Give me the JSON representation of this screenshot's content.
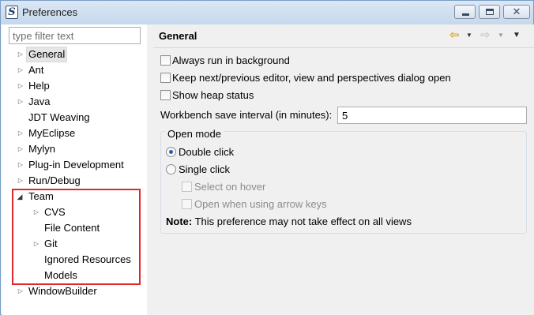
{
  "window": {
    "title": "Preferences",
    "icon": "app-s-icon"
  },
  "filter": {
    "placeholder": "type filter text"
  },
  "tree": {
    "items": [
      {
        "label": "General",
        "expander": "collapsed",
        "selected": true
      },
      {
        "label": "Ant",
        "expander": "collapsed"
      },
      {
        "label": "Help",
        "expander": "collapsed"
      },
      {
        "label": "Java",
        "expander": "collapsed"
      },
      {
        "label": "JDT Weaving",
        "expander": "none"
      },
      {
        "label": "MyEclipse",
        "expander": "collapsed"
      },
      {
        "label": "Mylyn",
        "expander": "collapsed"
      },
      {
        "label": "Plug-in Development",
        "expander": "collapsed"
      },
      {
        "label": "Run/Debug",
        "expander": "collapsed"
      },
      {
        "label": "Team",
        "expander": "expanded"
      },
      {
        "label": "CVS",
        "expander": "collapsed"
      },
      {
        "label": "File Content",
        "expander": "none"
      },
      {
        "label": "Git",
        "expander": "collapsed"
      },
      {
        "label": "Ignored Resources",
        "expander": "none"
      },
      {
        "label": "Models",
        "expander": "none"
      },
      {
        "label": "WindowBuilder",
        "expander": "collapsed"
      }
    ]
  },
  "page": {
    "title": "General",
    "options": {
      "always_run_background": {
        "label": "Always run in background",
        "checked": false
      },
      "keep_next_prev": {
        "label": "Keep next/previous editor, view and perspectives dialog open",
        "checked": false
      },
      "show_heap": {
        "label": "Show heap status",
        "checked": false
      }
    },
    "save_interval": {
      "label": "Workbench save interval (in minutes):",
      "value": "5"
    },
    "open_mode": {
      "title": "Open mode",
      "double_click": {
        "label": "Double click",
        "selected": true
      },
      "single_click": {
        "label": "Single click",
        "selected": false
      },
      "select_on_hover": {
        "label": "Select on hover",
        "enabled": false
      },
      "open_arrow_keys": {
        "label": "Open when using arrow keys",
        "enabled": false
      },
      "note_label": "Note:",
      "note_text": "This preference may not take effect on all views"
    }
  },
  "colors": {
    "highlight_box": "#e0272a",
    "back_arrow": "#d5a32b",
    "radio_dot": "#2a5fb0"
  }
}
